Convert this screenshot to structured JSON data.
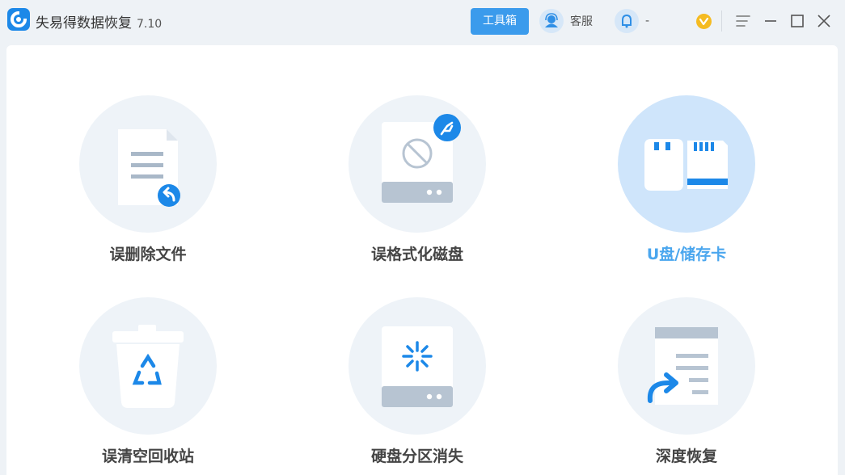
{
  "app": {
    "name": "失易得数据恢复",
    "version": "7.10"
  },
  "toolbar": {
    "toolbox_label": "工具箱",
    "service_label": "客服",
    "user_label": "-"
  },
  "colors": {
    "accent": "#3b9bec",
    "icon_blue": "#1c88e8",
    "active_label": "#4aa6ee",
    "circle_bg": "#eef3f8",
    "circle_active_bg": "#cfe5fb"
  },
  "modes": [
    {
      "label": "误删除文件",
      "icon": "deleted-file-icon",
      "active": false
    },
    {
      "label": "误格式化磁盘",
      "icon": "formatted-disk-icon",
      "active": false
    },
    {
      "label": "U盘/储存卡",
      "icon": "usb-sdcard-icon",
      "active": true
    },
    {
      "label": "误清空回收站",
      "icon": "recycle-bin-icon",
      "active": false
    },
    {
      "label": "硬盘分区消失",
      "icon": "lost-partition-icon",
      "active": false
    },
    {
      "label": "深度恢复",
      "icon": "deep-recovery-icon",
      "active": false
    }
  ]
}
